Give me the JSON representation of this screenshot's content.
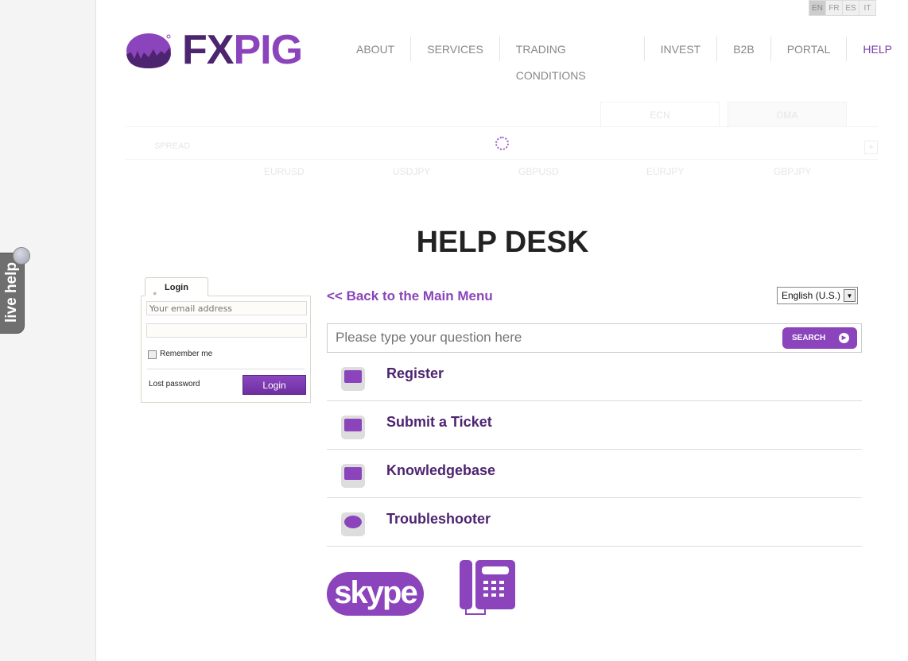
{
  "languages": [
    "EN",
    "FR",
    "ES",
    "IT"
  ],
  "live_help": "live help",
  "brand": {
    "name_dark": "FX",
    "name_light": "PIG",
    "dark": "#4d2470",
    "light": "#8b44bb"
  },
  "nav": [
    "ABOUT",
    "SERVICES",
    "TRADING CONDITIONS",
    "INVEST",
    "B2B",
    "PORTAL",
    "HELP"
  ],
  "nav_active": "HELP",
  "ticker": {
    "tabs": [
      "ECN",
      "DMA"
    ],
    "spread_label": "SPREAD",
    "plus": "+",
    "pairs": [
      "EURUSD",
      "USDJPY",
      "GBPUSD",
      "EURJPY",
      "GBPJPY"
    ]
  },
  "title": "HELP DESK",
  "login": {
    "tab": "Login",
    "email_placeholder": "Your email address",
    "remember": "Remember me",
    "lost": "Lost password",
    "button": "Login"
  },
  "back_link": "<< Back to the Main Menu",
  "language_select": "English (U.S.)",
  "search": {
    "placeholder": "Please type your question here",
    "button": "SEARCH"
  },
  "items": [
    {
      "label": "Register",
      "icon": "id-card-icon"
    },
    {
      "label": "Submit a Ticket",
      "icon": "envelope-icon"
    },
    {
      "label": "Knowledgebase",
      "icon": "binders-icon"
    },
    {
      "label": "Troubleshooter",
      "icon": "lightbulb-icon"
    }
  ],
  "skype_logo": "skype"
}
